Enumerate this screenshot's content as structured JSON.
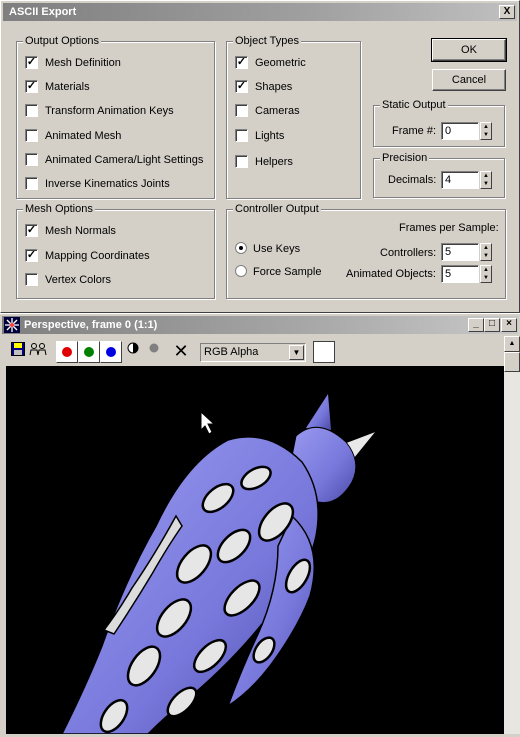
{
  "dialog": {
    "title": "ASCII Export",
    "close_label": "X",
    "output_options": {
      "label": "Output Options",
      "items": [
        {
          "label": "Mesh Definition",
          "checked": true
        },
        {
          "label": "Materials",
          "checked": true
        },
        {
          "label": "Transform Animation Keys",
          "checked": false
        },
        {
          "label": "Animated Mesh",
          "checked": false
        },
        {
          "label": "Animated Camera/Light Settings",
          "checked": false
        },
        {
          "label": "Inverse Kinematics Joints",
          "checked": false
        }
      ]
    },
    "object_types": {
      "label": "Object Types",
      "items": [
        {
          "label": "Geometric",
          "checked": true
        },
        {
          "label": "Shapes",
          "checked": true
        },
        {
          "label": "Cameras",
          "checked": false
        },
        {
          "label": "Lights",
          "checked": false
        },
        {
          "label": "Helpers",
          "checked": false
        }
      ]
    },
    "mesh_options": {
      "label": "Mesh Options",
      "items": [
        {
          "label": "Mesh Normals",
          "checked": true
        },
        {
          "label": "Mapping Coordinates",
          "checked": true
        },
        {
          "label": "Vertex Colors",
          "checked": false
        }
      ]
    },
    "ok_label": "OK",
    "cancel_label": "Cancel",
    "static_output": {
      "label": "Static Output",
      "frame_label": "Frame #:",
      "frame_value": "0"
    },
    "precision": {
      "label": "Precision",
      "decimals_label": "Decimals:",
      "decimals_value": "4"
    },
    "controller_output": {
      "label": "Controller Output",
      "frames_per_sample_label": "Frames per Sample:",
      "use_keys_label": "Use Keys",
      "force_sample_label": "Force Sample",
      "selected_mode": "Use Keys",
      "controllers_label": "Controllers:",
      "controllers_value": "5",
      "animated_objects_label": "Animated Objects:",
      "animated_objects_value": "5"
    }
  },
  "viewport": {
    "title": "Perspective, frame 0 (1:1)",
    "channel_select": "RGB Alpha",
    "channel_colors": [
      "#e00000",
      "#008000",
      "#0000e0"
    ],
    "model_color": "#7878dc",
    "background_color": "#000000"
  }
}
